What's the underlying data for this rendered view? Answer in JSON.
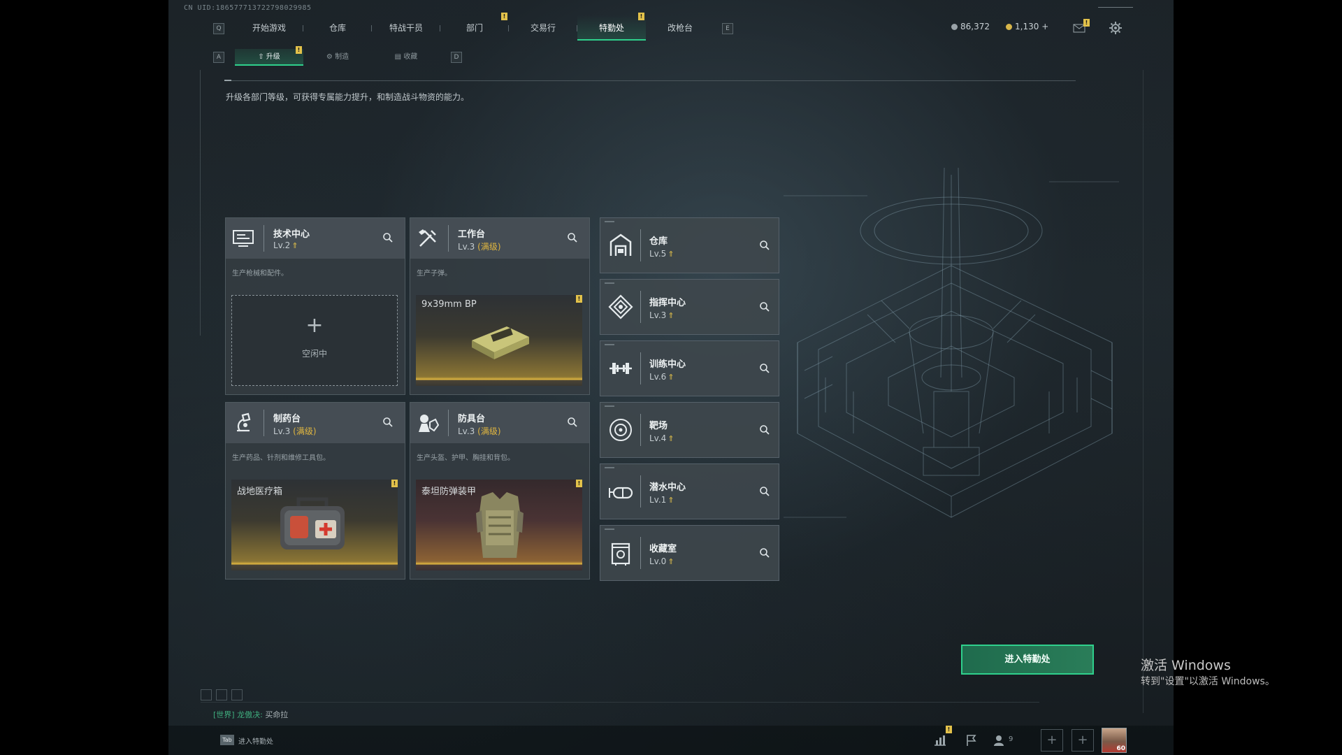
{
  "uid": "CN UID:186577713722798029985",
  "topbar": {
    "left_key": "Q",
    "right_key": "E",
    "tabs": [
      {
        "label": "开始游戏"
      },
      {
        "label": "仓库"
      },
      {
        "label": "特战干员"
      },
      {
        "label": "部门"
      },
      {
        "label": "交易行"
      },
      {
        "label": "特勤处",
        "active": true
      },
      {
        "label": "改枪台"
      }
    ],
    "currency1": "86,372",
    "currency2": "1,130",
    "currency2_plus": "+"
  },
  "subtabs": {
    "left_key": "A",
    "right_key": "D",
    "items": [
      {
        "label": "升级",
        "active": true
      },
      {
        "label": "制造"
      },
      {
        "label": "收藏"
      }
    ]
  },
  "description": "升级各部门等级，可获得专属能力提升，和制造战斗物资的能力。",
  "stations": [
    {
      "title": "技术中心",
      "level": "Lv.2",
      "full": "",
      "desc": "生产枪械和配件。",
      "slot_empty": true,
      "slot_plus": "+",
      "slot_idle": "空闲中",
      "icon": "tech-center-icon"
    },
    {
      "title": "工作台",
      "level": "Lv.3",
      "full": "(满级)",
      "desc": "生产子弹。",
      "slot_item": "9x39mm BP",
      "icon": "workbench-icon"
    },
    {
      "title": "制药台",
      "level": "Lv.3",
      "full": "(满级)",
      "desc": "生产药品、针剂和维修工具包。",
      "slot_item": "战地医疗箱",
      "icon": "pharmacy-icon"
    },
    {
      "title": "防具台",
      "level": "Lv.3",
      "full": "(满级)",
      "desc": "生产头盔、护甲、胸挂和背包。",
      "slot_item": "泰坦防弹装甲",
      "icon": "armor-bench-icon"
    }
  ],
  "buildings": [
    {
      "title": "仓库",
      "level": "Lv.5",
      "icon": "warehouse-icon"
    },
    {
      "title": "指挥中心",
      "level": "Lv.3",
      "icon": "command-center-icon"
    },
    {
      "title": "训练中心",
      "level": "Lv.6",
      "icon": "training-center-icon"
    },
    {
      "title": "靶场",
      "level": "Lv.4",
      "icon": "shooting-range-icon"
    },
    {
      "title": "潜水中心",
      "level": "Lv.1",
      "icon": "diving-center-icon"
    },
    {
      "title": "收藏室",
      "level": "Lv.0",
      "icon": "collection-room-icon"
    }
  ],
  "enter_button": "进入特勤处",
  "chat": {
    "channel": "[世界]",
    "user": "龙傲决:",
    "message": "买命拉"
  },
  "bottom": {
    "tab_key": "Tab",
    "tab_label": "进入特勤处",
    "friends_count": "9",
    "avatar_level": "60"
  },
  "watermark": {
    "line1": "激活 Windows",
    "line2": "转到\"设置\"以激活 Windows。"
  },
  "colors": {
    "accent": "#2fd08c",
    "badge": "#e2c14a",
    "max_level": "#e0b640"
  }
}
